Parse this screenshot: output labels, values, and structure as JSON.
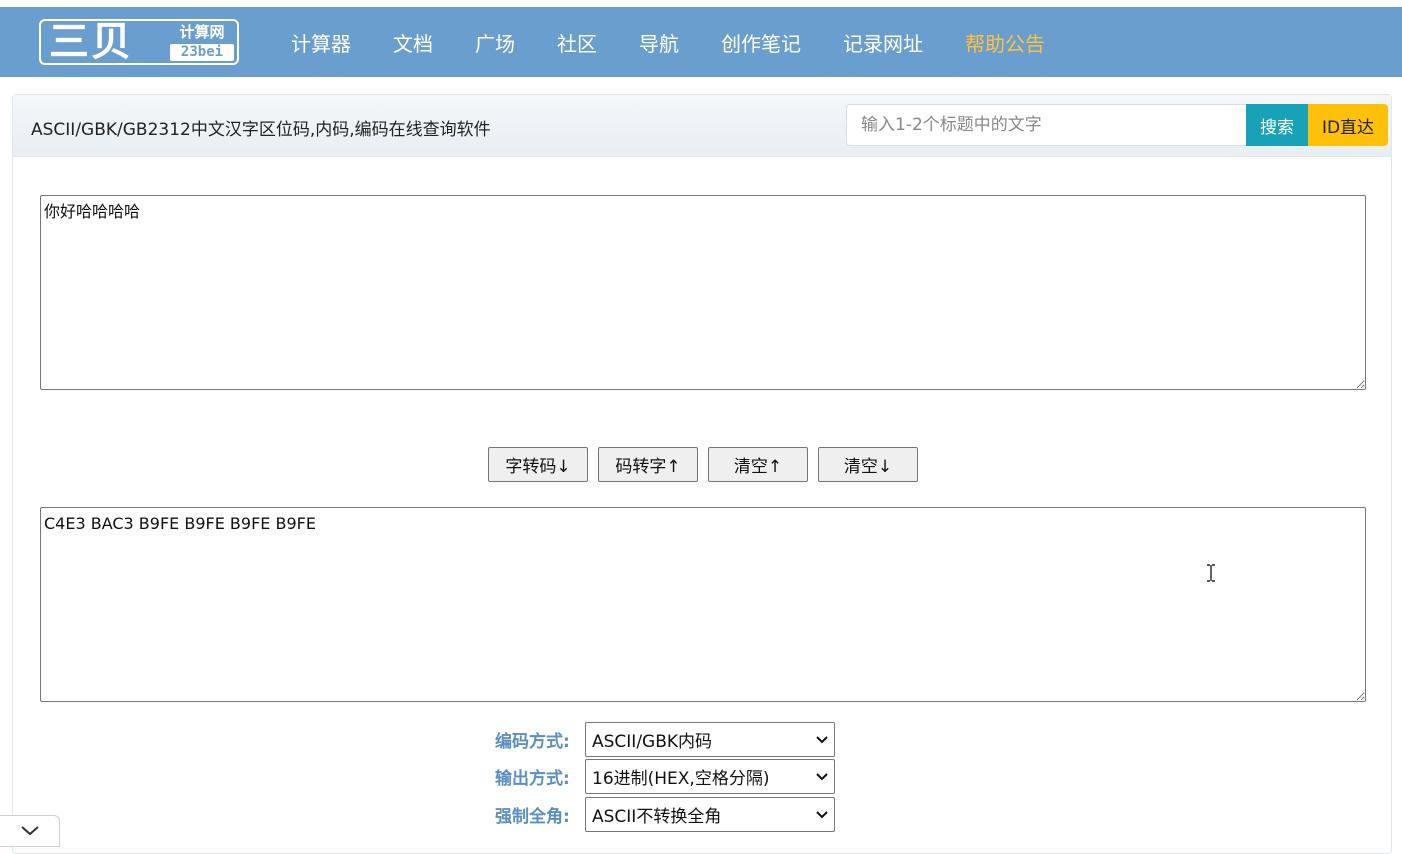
{
  "header": {
    "logo_main": "三贝",
    "logo_cn": "计算网",
    "logo_en": "23bei",
    "nav": [
      {
        "label": "计算器"
      },
      {
        "label": "文档"
      },
      {
        "label": "广场"
      },
      {
        "label": "社区"
      },
      {
        "label": "导航"
      },
      {
        "label": "创作笔记"
      },
      {
        "label": "记录网址"
      },
      {
        "label": "帮助公告"
      }
    ],
    "nav_highlight_color": "#ffc23a",
    "bar_color": "#6a9ecf"
  },
  "page": {
    "title": "ASCII/GBK/GB2312中文汉字区位码,内码,编码在线查询软件"
  },
  "search": {
    "placeholder": "输入1-2个标题中的文字",
    "value": "",
    "search_label": "搜索",
    "id_label": "ID直达",
    "search_color": "#17a2b8",
    "id_color": "#ffc107"
  },
  "converter": {
    "input_text": "你好哈哈哈哈",
    "output_text": "C4E3 BAC3 B9FE B9FE B9FE B9FE",
    "buttons": {
      "char_to_code": "字转码↓",
      "code_to_char": "码转字↑",
      "clear_up": "清空↑",
      "clear_down": "清空↓"
    }
  },
  "options": {
    "encoding_label": "编码方式:",
    "encoding_value": "ASCII/GBK内码",
    "output_label": "输出方式:",
    "output_value": "16进制(HEX,空格分隔)",
    "fullwidth_label": "强制全角:",
    "fullwidth_value": "ASCII不转换全角"
  },
  "icons": {
    "corner": "chevron-down-icon",
    "cursor": "text-cursor-icon",
    "select_arrow": "chevron-down-icon"
  }
}
